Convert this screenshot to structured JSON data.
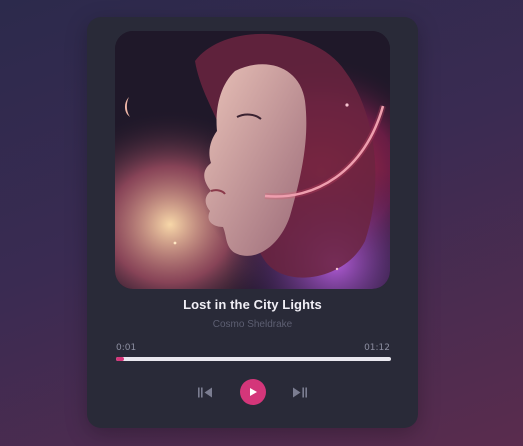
{
  "track": {
    "title": "Lost in the City Lights",
    "artist": "Cosmo Sheldrake",
    "cover_icon": "album-cover-art"
  },
  "playback": {
    "current_time": "0:01",
    "total_time": "01:12",
    "progress_fraction": 0.03
  },
  "controls": {
    "previous_icon": "skip-previous-icon",
    "play_icon": "play-icon",
    "next_icon": "skip-next-icon"
  },
  "colors": {
    "accent": "#d4367a",
    "card": "#292a38",
    "title": "#f1eff6",
    "muted": "#5d5f72"
  }
}
